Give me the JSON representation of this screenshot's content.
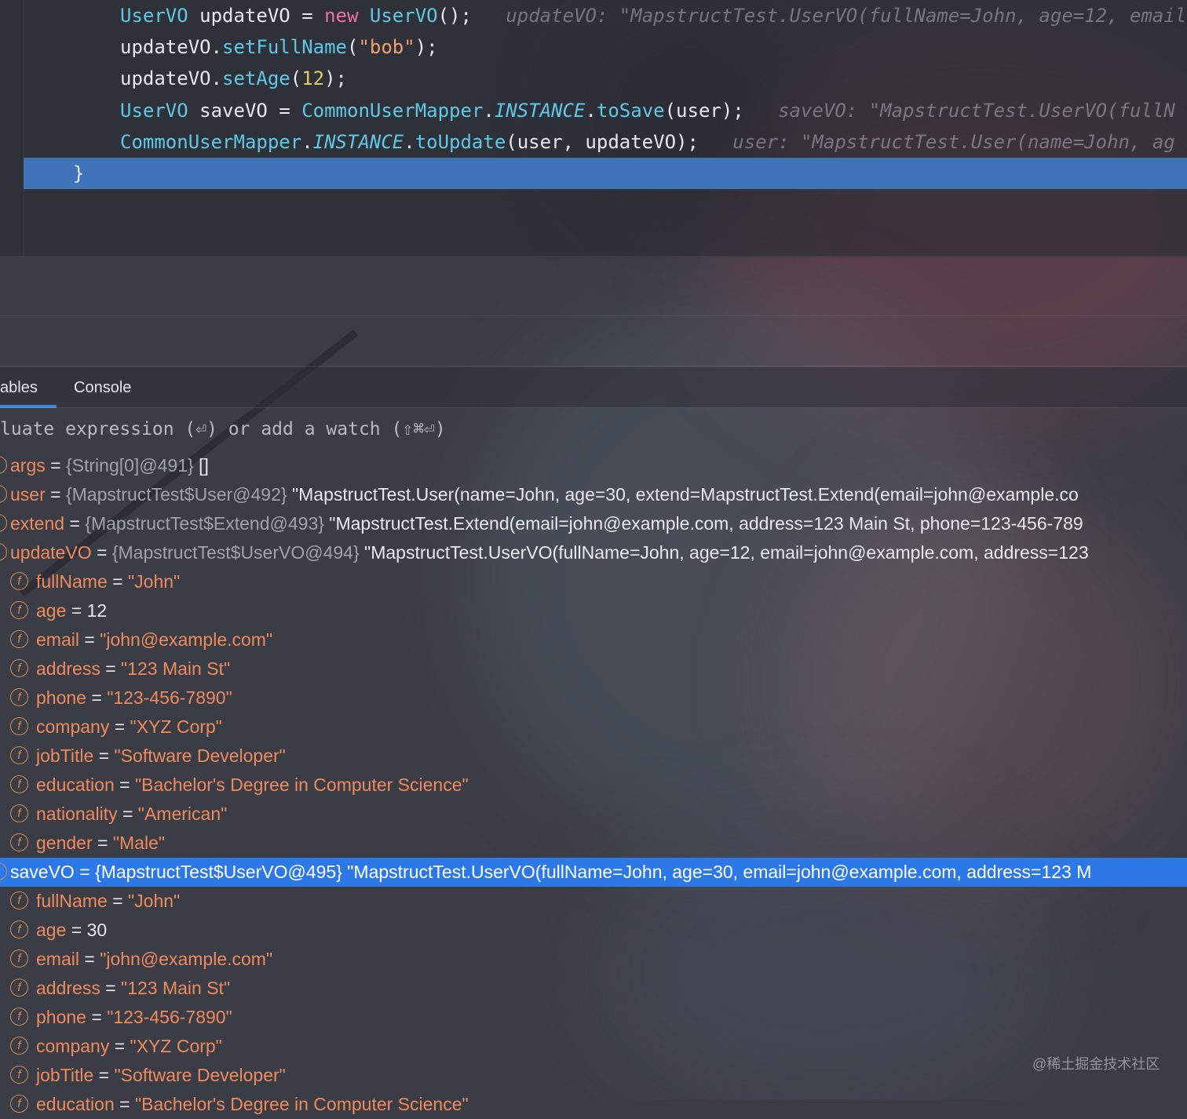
{
  "editor": {
    "lines": [
      {
        "tokens": [
          {
            "t": "UserVO",
            "c": "kw-type"
          },
          {
            "t": " updateVO = ",
            "c": "plain"
          },
          {
            "t": "new",
            "c": "kw-new"
          },
          {
            "t": " ",
            "c": "plain"
          },
          {
            "t": "UserVO",
            "c": "kw-type"
          },
          {
            "t": "();",
            "c": "plain"
          },
          {
            "t": "   updateVO: \"MapstructTest.UserVO(fullName=John, age=12, email",
            "c": "hint"
          }
        ]
      },
      {
        "tokens": [
          {
            "t": "updateVO.",
            "c": "plain"
          },
          {
            "t": "setFullName",
            "c": "method"
          },
          {
            "t": "(",
            "c": "plain"
          },
          {
            "t": "\"bob\"",
            "c": "str"
          },
          {
            "t": ");",
            "c": "plain"
          }
        ]
      },
      {
        "tokens": [
          {
            "t": "updateVO.",
            "c": "plain"
          },
          {
            "t": "setAge",
            "c": "method"
          },
          {
            "t": "(",
            "c": "plain"
          },
          {
            "t": "12",
            "c": "num"
          },
          {
            "t": ");",
            "c": "plain"
          }
        ]
      },
      {
        "tokens": [
          {
            "t": "UserVO",
            "c": "kw-type"
          },
          {
            "t": " saveVO = ",
            "c": "plain"
          },
          {
            "t": "CommonUserMapper",
            "c": "kw-type"
          },
          {
            "t": ".",
            "c": "plain"
          },
          {
            "t": "INSTANCE",
            "c": "static"
          },
          {
            "t": ".",
            "c": "plain"
          },
          {
            "t": "toSave",
            "c": "method"
          },
          {
            "t": "(user);",
            "c": "plain"
          },
          {
            "t": "   saveVO: \"MapstructTest.UserVO(fullN",
            "c": "hint"
          }
        ]
      },
      {
        "tokens": [
          {
            "t": "CommonUserMapper",
            "c": "kw-type"
          },
          {
            "t": ".",
            "c": "plain"
          },
          {
            "t": "INSTANCE",
            "c": "static"
          },
          {
            "t": ".",
            "c": "plain"
          },
          {
            "t": "toUpdate",
            "c": "method"
          },
          {
            "t": "(user, updateVO);",
            "c": "plain"
          },
          {
            "t": "   user: \"MapstructTest.User(name=John, ag",
            "c": "hint"
          }
        ]
      },
      {
        "tokens": [
          {
            "t": "}",
            "c": "plain"
          }
        ]
      }
    ]
  },
  "debugger": {
    "tabs": [
      "ables",
      "Console"
    ],
    "eval_placeholder": "luate expression (⏎) or add a watch (⇧⌘⏎)",
    "variables": [
      {
        "indent": 0,
        "name": "args",
        "type": "{String[0]@491}",
        "value": " []",
        "kind": "plain"
      },
      {
        "indent": 0,
        "name": "user",
        "type": "{MapstructTest$User@492}",
        "value": " \"MapstructTest.User(name=John, age=30, extend=MapstructTest.Extend(email=john@example.co",
        "kind": "plain"
      },
      {
        "indent": 0,
        "name": "extend",
        "type": "{MapstructTest$Extend@493}",
        "value": " \"MapstructTest.Extend(email=john@example.com, address=123 Main St, phone=123-456-789",
        "kind": "plain"
      },
      {
        "indent": 0,
        "name": "updateVO",
        "type": "{MapstructTest$UserVO@494}",
        "value": " \"MapstructTest.UserVO(fullName=John, age=12, email=john@example.com, address=123",
        "kind": "plain"
      },
      {
        "indent": 1,
        "name": "fullName",
        "value": "\"John\"",
        "kind": "str"
      },
      {
        "indent": 1,
        "name": "age",
        "value": "12",
        "kind": "num"
      },
      {
        "indent": 1,
        "name": "email",
        "value": "\"john@example.com\"",
        "kind": "str"
      },
      {
        "indent": 1,
        "name": "address",
        "value": "\"123 Main St\"",
        "kind": "str"
      },
      {
        "indent": 1,
        "name": "phone",
        "value": "\"123-456-7890\"",
        "kind": "str"
      },
      {
        "indent": 1,
        "name": "company",
        "value": "\"XYZ Corp\"",
        "kind": "str"
      },
      {
        "indent": 1,
        "name": "jobTitle",
        "value": "\"Software Developer\"",
        "kind": "str"
      },
      {
        "indent": 1,
        "name": "education",
        "value": "\"Bachelor's Degree in Computer Science\"",
        "kind": "str"
      },
      {
        "indent": 1,
        "name": "nationality",
        "value": "\"American\"",
        "kind": "str"
      },
      {
        "indent": 1,
        "name": "gender",
        "value": "\"Male\"",
        "kind": "str"
      },
      {
        "indent": 0,
        "name": "saveVO",
        "type": "{MapstructTest$UserVO@495}",
        "value": " \"MapstructTest.UserVO(fullName=John, age=30, email=john@example.com, address=123 M",
        "kind": "plain",
        "selected": true
      },
      {
        "indent": 1,
        "name": "fullName",
        "value": "\"John\"",
        "kind": "str"
      },
      {
        "indent": 1,
        "name": "age",
        "value": "30",
        "kind": "num"
      },
      {
        "indent": 1,
        "name": "email",
        "value": "\"john@example.com\"",
        "kind": "str"
      },
      {
        "indent": 1,
        "name": "address",
        "value": "\"123 Main St\"",
        "kind": "str"
      },
      {
        "indent": 1,
        "name": "phone",
        "value": "\"123-456-7890\"",
        "kind": "str"
      },
      {
        "indent": 1,
        "name": "company",
        "value": "\"XYZ Corp\"",
        "kind": "str"
      },
      {
        "indent": 1,
        "name": "jobTitle",
        "value": "\"Software Developer\"",
        "kind": "str"
      },
      {
        "indent": 1,
        "name": "education",
        "value": "\"Bachelor's Degree in Computer Science\"",
        "kind": "str"
      }
    ],
    "field_icon_glyph": "f"
  },
  "watermark": "@稀土掘金技术社区",
  "colors": {
    "accent": "#2c78e6",
    "exec_line": "#3f74b8",
    "var_name": "#f08a5d"
  }
}
